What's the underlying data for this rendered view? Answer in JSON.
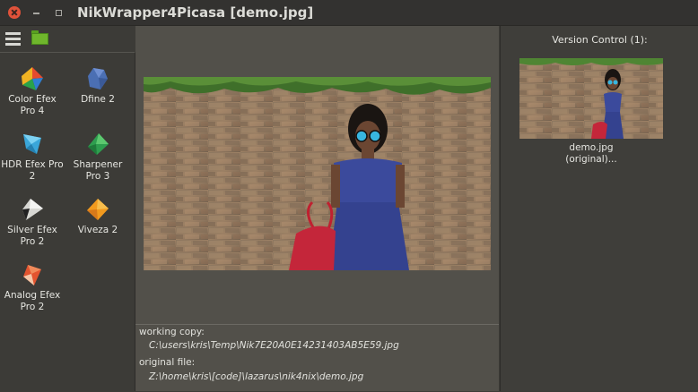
{
  "window": {
    "title": "NikWrapper4Picasa [demo.jpg]"
  },
  "toolbar": {
    "icons": [
      "menu-icon",
      "folder-icon"
    ]
  },
  "tools": [
    {
      "label": "Color Efex Pro 4",
      "icon": "color-efex-icon"
    },
    {
      "label": "Dfine 2",
      "icon": "dfine-icon"
    },
    {
      "label": "HDR Efex Pro 2",
      "icon": "hdr-efex-icon"
    },
    {
      "label": "Sharpener Pro 3",
      "icon": "sharpener-icon"
    },
    {
      "label": "Silver Efex Pro 2",
      "icon": "silver-efex-icon"
    },
    {
      "label": "Viveza 2",
      "icon": "viveza-icon"
    },
    {
      "label": "Analog Efex Pro 2",
      "icon": "analog-efex-icon"
    }
  ],
  "paths": {
    "working_label": "working copy:",
    "working_value": "C:\\users\\kris\\Temp\\Nik7E20A0E14231403AB5E59.jpg",
    "original_label": "original file:",
    "original_value": "Z:\\home\\kris\\[code]\\lazarus\\nik4nix\\demo.jpg"
  },
  "version_control": {
    "title": "Version Control (1):",
    "items": [
      {
        "line1": "demo.jpg",
        "line2": "(original)..."
      }
    ]
  },
  "colors": {
    "close": "#e0523a",
    "panel_bg": "#3c3b37",
    "center_bg": "#52504a"
  }
}
